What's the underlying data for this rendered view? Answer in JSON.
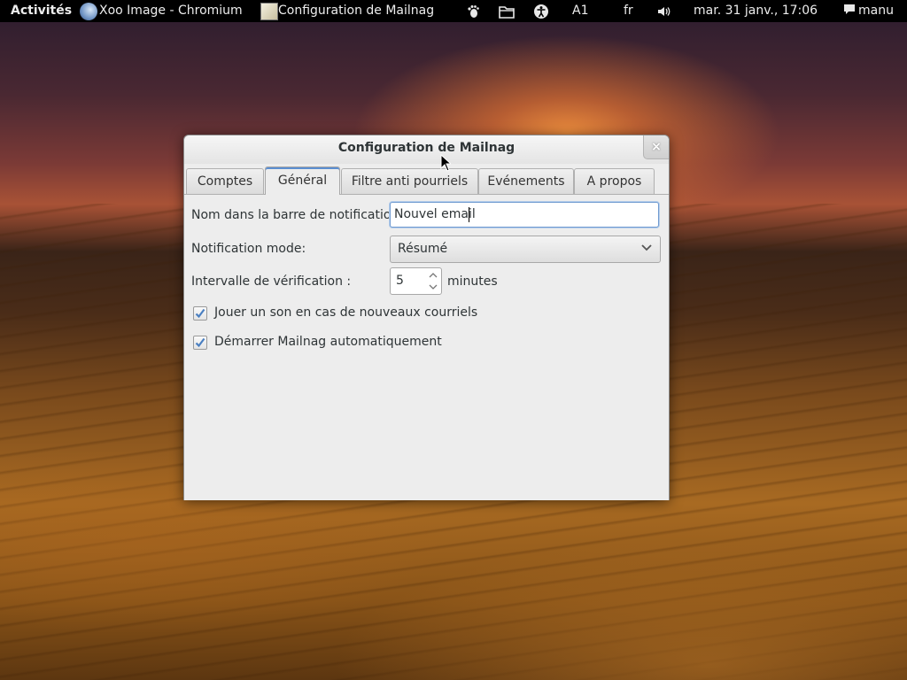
{
  "topbar": {
    "activities": "Activités",
    "app1": "Xoo Image - Chromium",
    "app2": "Configuration de Mailnag",
    "keyboard_label": "A",
    "keyboard_index": "1",
    "language": "fr",
    "datetime": "mar. 31 janv., 17:06",
    "user": "manu",
    "icons": [
      "gnome-foot-icon",
      "folder-icon",
      "accessibility-icon",
      "volume-icon",
      "chat-bubble-icon"
    ]
  },
  "window": {
    "title": "Configuration de Mailnag",
    "close": "×",
    "tabs": [
      {
        "label": "Comptes"
      },
      {
        "label": "Général"
      },
      {
        "label": "Filtre anti pourriels"
      },
      {
        "label": "Evénements"
      },
      {
        "label": "A propos"
      }
    ],
    "active_tab": "Général"
  },
  "general": {
    "name_label": "Nom dans la barre de notification:",
    "name_value": "Nouvel email",
    "mode_label": "Notification mode:",
    "mode_value": "Résumé",
    "interval_label": "Intervalle de vérification :",
    "interval_value": "5",
    "interval_unit": "minutes",
    "sound_label": "Jouer un son en cas de nouveaux courriels",
    "sound_checked": true,
    "autostart_label": "Démarrer Mailnag automatiquement",
    "autostart_checked": true
  },
  "colors": {
    "accent": "#5b8ed1",
    "checkmark": "#4a7fc1"
  }
}
